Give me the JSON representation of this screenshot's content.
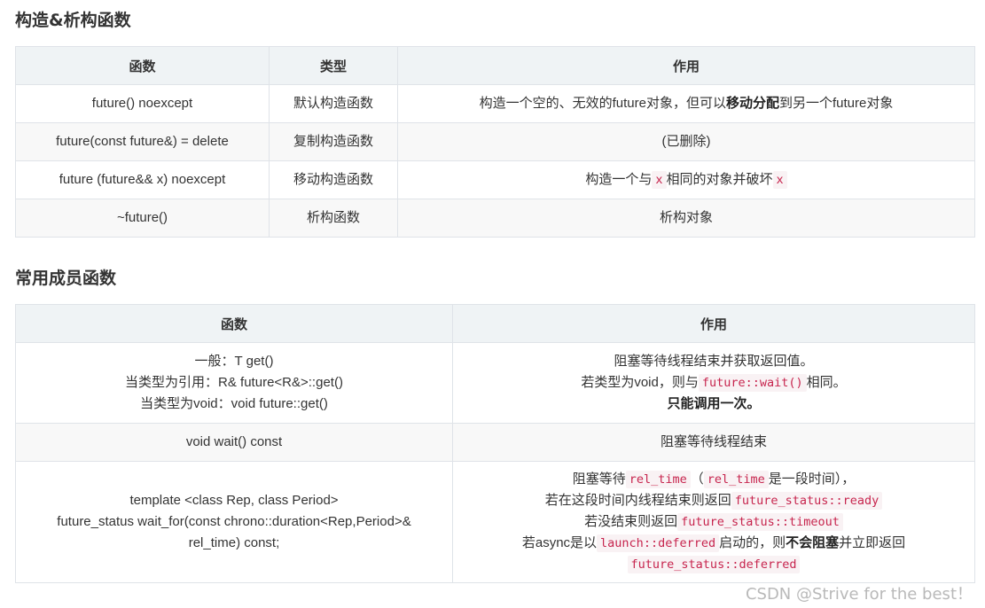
{
  "section1": {
    "title": "构造&析构函数",
    "headers": [
      "函数",
      "类型",
      "作用"
    ],
    "rows": [
      {
        "func": "future() noexcept",
        "type": "默认构造函数",
        "effect_pre": "构造一个空的、无效的future对象，但可以",
        "effect_bold": "移动分配",
        "effect_post": "到另一个future对象"
      },
      {
        "func": "future(const future&) = delete",
        "type": "复制构造函数",
        "effect": "(已删除)"
      },
      {
        "func": "future (future&& x) noexcept",
        "type": "移动构造函数",
        "effect_pre": "构造一个与",
        "effect_code1": "x",
        "effect_mid": "相同的对象并破坏",
        "effect_code2": "x"
      },
      {
        "func": "~future()",
        "type": "析构函数",
        "effect": "析构对象"
      }
    ]
  },
  "section2": {
    "title": "常用成员函数",
    "headers": [
      "函数",
      "作用"
    ],
    "rows": [
      {
        "func_lines": [
          "一般：T get()",
          "当类型为引用：R& future<R&>::get()",
          "当类型为void：void future::get()"
        ],
        "effect_line1": "阻塞等待线程结束并获取返回值。",
        "effect_line2_pre": "若类型为void，则与",
        "effect_line2_code": "future::wait()",
        "effect_line2_post": "相同。",
        "effect_line3_bold": "只能调用一次。"
      },
      {
        "func": "void wait() const",
        "effect": "阻塞等待线程结束"
      },
      {
        "func_lines": [
          "template <class Rep, class Period>",
          "future_status wait_for(const chrono::duration<Rep,Period>&",
          "rel_time) const;"
        ],
        "l1_pre": "阻塞等待",
        "l1_code1": "rel_time",
        "l1_mid": "（",
        "l1_code2": "rel_time",
        "l1_post": "是一段时间），",
        "l2_pre": "若在这段时间内线程结束则返回",
        "l2_code": "future_status::ready",
        "l3_pre": "若没结束则返回",
        "l3_code": "future_status::timeout",
        "l4_pre": "若async是以",
        "l4_code": "launch::deferred",
        "l4_mid": "启动的，则",
        "l4_bold": "不会阻塞",
        "l4_post": "并立即返回",
        "l5_code": "future_status::deferred"
      }
    ]
  },
  "watermark": "CSDN @Strive for the best！"
}
